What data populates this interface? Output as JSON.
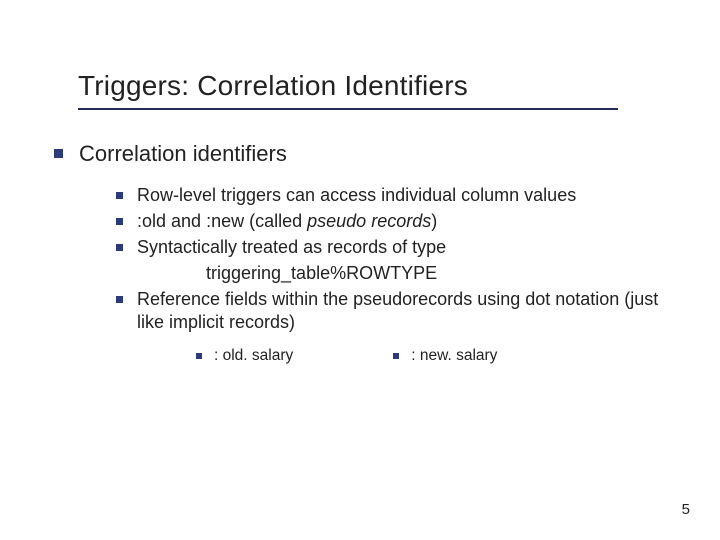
{
  "title": "Triggers: Correlation Identifiers",
  "heading": "Correlation identifiers",
  "bullets": [
    {
      "text": "Row-level triggers can access individual column values"
    },
    {
      "prefix": ":old ",
      "mid1": "and",
      "mid2": " :new ",
      "mid3": "(called ",
      "italic": "pseudo records",
      "suffix": ")"
    },
    {
      "text": "Syntactically treated as records of type",
      "sub": "triggering_table%ROWTYPE"
    },
    {
      "text": "Reference fields within the pseudorecords using dot notation (just like implicit records)"
    }
  ],
  "examples": [
    ": old. salary",
    ": new. salary"
  ],
  "page": "5"
}
